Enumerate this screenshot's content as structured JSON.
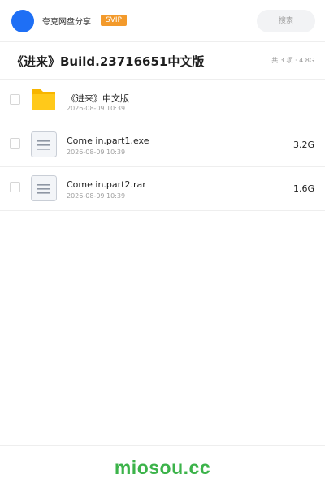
{
  "header": {
    "user_name": "夸克网盘分享",
    "badge": "SVIP",
    "search_placeholder": "搜索",
    "colors": {
      "avatar": "#1e6ff5",
      "badge": "#f39a2b"
    }
  },
  "title_bar": {
    "title": "《进来》Build.23716651中文版",
    "summary": "共 3 项 · 4.8G"
  },
  "files": [
    {
      "name": "《进来》中文版",
      "date": "2026-08-09 10:39",
      "size": "",
      "icon": "folder-icon"
    },
    {
      "name": "Come in.part1.exe",
      "date": "2026-08-09 10:39",
      "size": "3.2G",
      "icon": "file-icon"
    },
    {
      "name": "Come in.part2.rar",
      "date": "2026-08-09 10:39",
      "size": "1.6G",
      "icon": "file-icon"
    }
  ],
  "footer": {
    "watermark": "miosou.cc",
    "color": "#3cb34a"
  }
}
